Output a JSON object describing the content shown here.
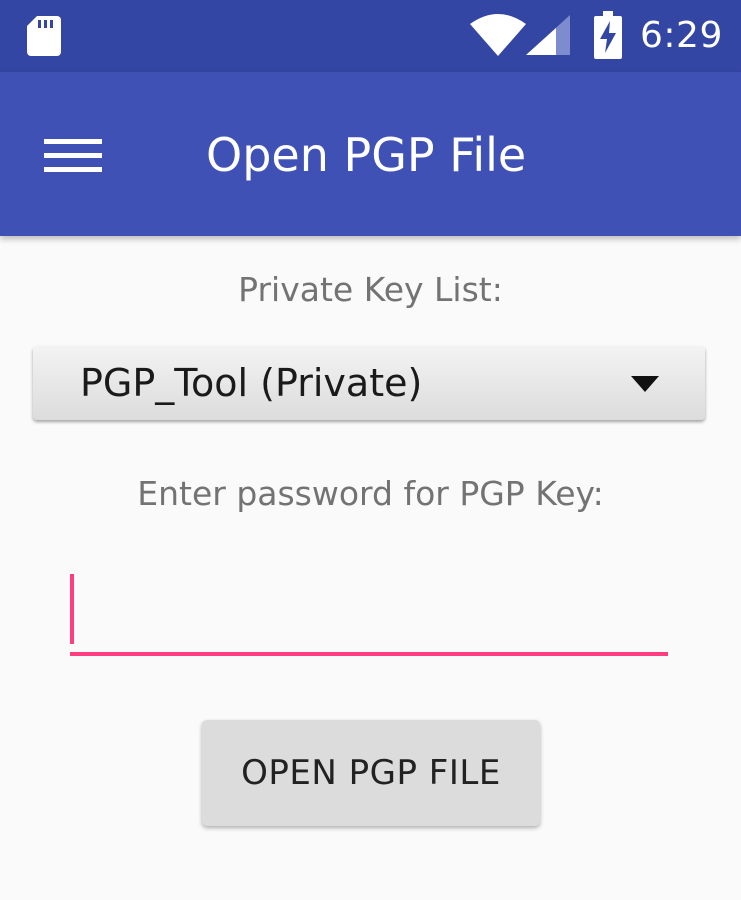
{
  "status_bar": {
    "time": "6:29",
    "icons": [
      "sd-card-icon",
      "wifi-icon",
      "signal-icon",
      "battery-charging-icon"
    ]
  },
  "app_bar": {
    "title": "Open PGP File",
    "nav_icon": "menu-icon"
  },
  "form": {
    "key_list_label": "Private Key List:",
    "selected_key": "PGP_Tool (Private)",
    "password_label": "Enter password for PGP Key:",
    "password_value": "",
    "open_button_label": "OPEN PGP FILE"
  },
  "colors": {
    "status_bar": "#3346a3",
    "app_bar": "#3f51b5",
    "accent": "#ff3d7f",
    "background": "#fafafa",
    "button": "#dcdcdc"
  }
}
